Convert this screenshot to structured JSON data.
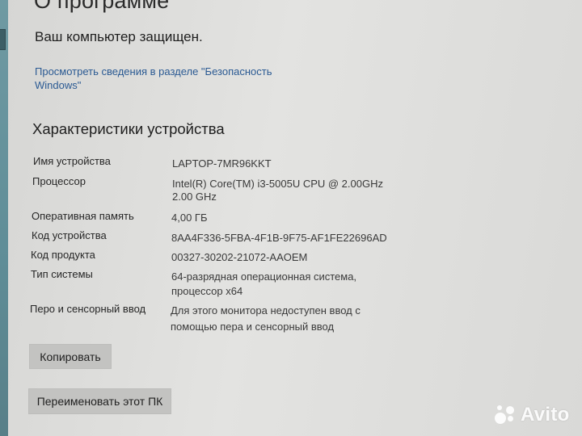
{
  "page_title": "О программе",
  "protected_text": "Ваш компьютер защищен.",
  "security_link": "Просмотреть сведения в разделе \"Безопасность Windows\"",
  "section_title": "Характеристики устройства",
  "specs": [
    {
      "label": "Имя устройства",
      "value": "LAPTOP-7MR96KKT"
    },
    {
      "label": "Процессор",
      "value": "Intel(R) Core(TM) i3-5005U CPU @ 2.00GHz",
      "value2": "2.00 GHz"
    },
    {
      "label": "Оперативная память",
      "value": "4,00 ГБ"
    },
    {
      "label": "Код устройства",
      "value": "8AA4F336-5FBA-4F1B-9F75-AF1FE22696AD"
    },
    {
      "label": "Код продукта",
      "value": "00327-30202-21072-AAOEM"
    },
    {
      "label": "Тип системы",
      "value": "64-разрядная операционная система,",
      "value2": "процессор x64"
    },
    {
      "label": "Перо и сенсорный ввод",
      "value": "Для этого монитора недоступен ввод с",
      "value2": "помощью пера и сенсорный ввод"
    }
  ],
  "buttons": {
    "copy": "Копировать",
    "rename": "Переименовать этот ПК"
  },
  "watermark": "Avito"
}
